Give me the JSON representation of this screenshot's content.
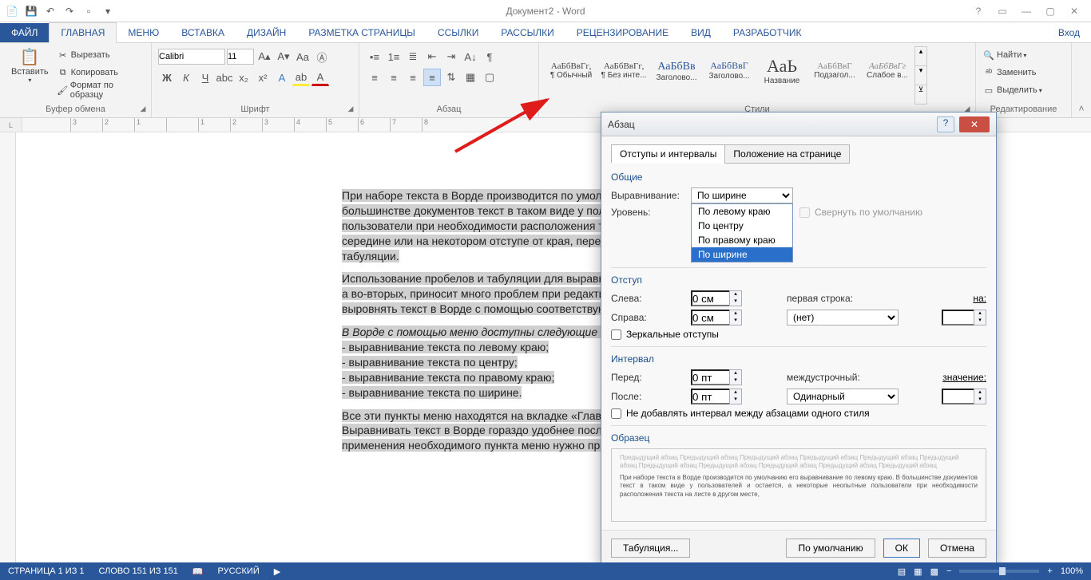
{
  "window": {
    "title": "Документ2 - Word",
    "signin": "Вход"
  },
  "tabs": {
    "file": "ФАЙЛ",
    "home": "ГЛАВНАЯ",
    "menu": "Меню",
    "insert": "ВСТАВКА",
    "design": "ДИЗАЙН",
    "layout": "РАЗМЕТКА СТРАНИЦЫ",
    "refs": "ССЫЛКИ",
    "mail": "РАССЫЛКИ",
    "review": "РЕЦЕНЗИРОВАНИЕ",
    "view": "ВИД",
    "dev": "РАЗРАБОТЧИК"
  },
  "clipboard": {
    "paste": "Вставить",
    "cut": "Вырезать",
    "copy": "Копировать",
    "format": "Формат по образцу",
    "group": "Буфер обмена"
  },
  "font": {
    "name": "Calibri",
    "size": "11",
    "group": "Шрифт"
  },
  "para": {
    "group": "Абзац"
  },
  "styles": {
    "group": "Стили",
    "s1": {
      "p": "АаБбВвГг,",
      "n": "¶ Обычный"
    },
    "s2": {
      "p": "АаБбВвГг,",
      "n": "¶ Без инте..."
    },
    "s3": {
      "p": "АаБбВв",
      "n": "Заголово..."
    },
    "s4": {
      "p": "АаБбВвГ",
      "n": "Заголово..."
    },
    "s5": {
      "p": "АаЬ",
      "n": "Название"
    },
    "s6": {
      "p": "АаБбВвГ",
      "n": "Подзагол..."
    },
    "s7": {
      "p": "АаБбВвГг",
      "n": "Слабое в..."
    }
  },
  "editing": {
    "find": "Найти",
    "replace": "Заменить",
    "select": "Выделить",
    "group": "Редактирование"
  },
  "doc": {
    "p1": "При наборе текста в Ворде производится по умолча",
    "p1b": "большинстве документов текст в таком виде у пользо",
    "p1c": "пользователи при необходимости расположения тек",
    "p1d": "середине или на некотором отступе от края, пере",
    "p1e": "табуляции.",
    "p2a": "Использование пробелов и табуляции для выравниван",
    "p2b": "а во-вторых, приносит много проблем при редактиро",
    "p2c": "выровнять текст в Ворде с помощью соответствующих",
    "p3": "В Ворде с помощью меню доступны следующие вари",
    "l1": "- выравнивание текста по левому краю;",
    "l2": "- выравнивание текста по центру;",
    "l3": "- выравнивание текста по правому краю;",
    "l4": "- выравнивание текста по ширине.",
    "p4a": "Все эти пункты меню находятся на вкладке «Главная»",
    "p4b": "Выравнивать текст в Ворде гораздо удобнее после",
    "p4c": "применения необходимого пункта меню нужно предва"
  },
  "dialog": {
    "title": "Абзац",
    "tab1": "Отступы и интервалы",
    "tab2": "Положение на странице",
    "sec_general": "Общие",
    "align_label": "Выравнивание:",
    "align_value": "По ширине",
    "align_opts": {
      "o1": "По левому краю",
      "o2": "По центру",
      "o3": "По правому краю",
      "o4": "По ширине"
    },
    "level_label": "Уровень:",
    "collapse_chk": "Свернуть по умолчанию",
    "sec_indent": "Отступ",
    "left_label": "Слева:",
    "left_val": "0 см",
    "right_label": "Справа:",
    "right_val": "0 см",
    "firstline_label": "первая строка:",
    "firstline_val": "(нет)",
    "by_label": "на:",
    "mirror_chk": "Зеркальные отступы",
    "sec_spacing": "Интервал",
    "before_label": "Перед:",
    "before_val": "0 пт",
    "after_label": "После:",
    "after_val": "0 пт",
    "linesp_label": "междустрочный:",
    "linesp_val": "Одинарный",
    "value_label": "значение:",
    "nocontext_chk": "Не добавлять интервал между абзацами одного стиля",
    "sec_sample": "Образец",
    "sample_gray": "Предыдущий абзац Предыдущий абзац Предыдущий абзац Предыдущий абзац Предыдущий абзац Предыдущий абзац Предыдущий абзац Предыдущий абзац Предыдущий абзац Предыдущий абзац Предыдущий абзац",
    "sample_dark": "При наборе текста в Ворде производится по умолчанию его выравнивание по левому краю. В большинстве документов текст в таком виде у пользователей и остается, а некоторые неопытные пользователи при необходимости расположения текста на листе в другом месте,",
    "btn_tabs": "Табуляция...",
    "btn_default": "По умолчанию",
    "btn_ok": "ОК",
    "btn_cancel": "Отмена"
  },
  "status": {
    "page": "СТРАНИЦА 1 ИЗ 1",
    "words": "СЛОВО 151 ИЗ 151",
    "lang": "РУССКИЙ",
    "zoom": "100%"
  },
  "ruler": {
    "marks": [
      "3",
      "2",
      "1",
      "",
      "1",
      "2",
      "3",
      "4",
      "5",
      "6",
      "7",
      "8"
    ]
  }
}
